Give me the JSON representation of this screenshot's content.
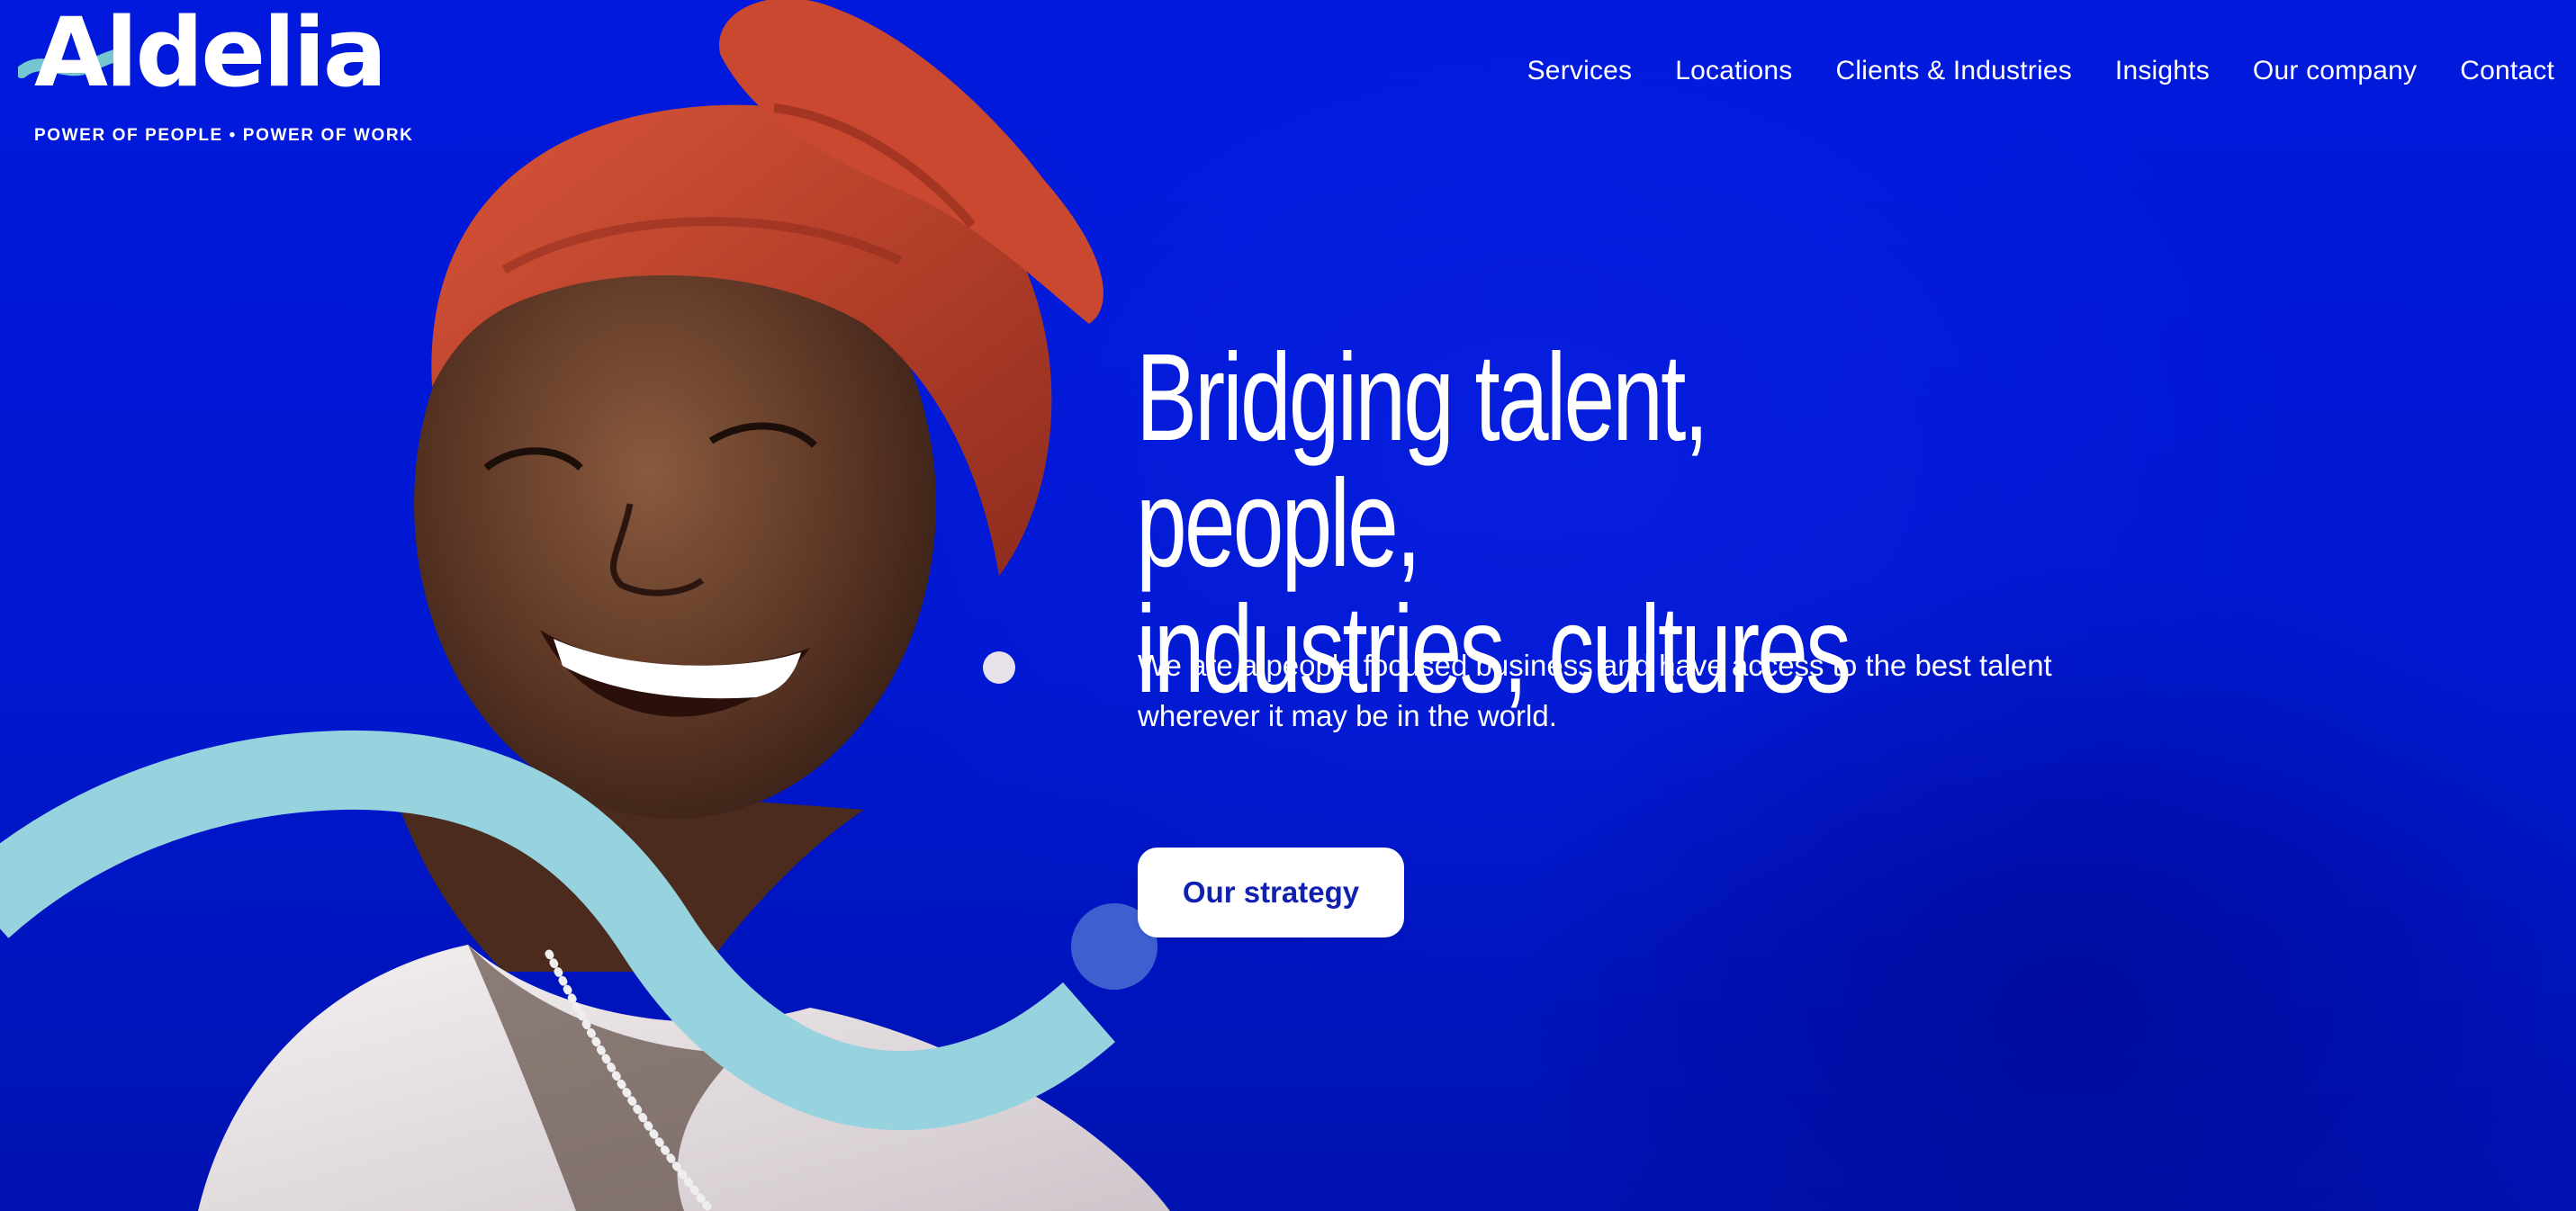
{
  "brand": {
    "name": "Aldelia",
    "tagline": "POWER OF PEOPLE • POWER OF WORK",
    "primary_color": "#0019d6",
    "accent_color": "#96d3de"
  },
  "nav": {
    "items": [
      {
        "label": "Services"
      },
      {
        "label": "Locations"
      },
      {
        "label": "Clients & Industries"
      },
      {
        "label": "Insights"
      },
      {
        "label": "Our company"
      },
      {
        "label": "Contact"
      }
    ]
  },
  "hero": {
    "title_line1": "Bridging talent, people,",
    "title_line2": "industries, cultures",
    "subtitle_line1": "We are a people focused business and have access to the best talent",
    "subtitle_line2": "wherever it may be in the world.",
    "cta_label": "Our strategy",
    "image_description_icon": "portrait-photo"
  }
}
